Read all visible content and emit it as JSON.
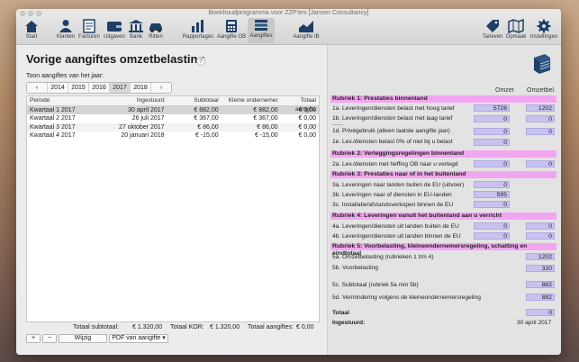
{
  "window": {
    "title": "Boekhoudprogramma voor ZZP'ers [Jansen Consultancy]"
  },
  "toolbar": {
    "items": [
      {
        "label": "Start",
        "icon": "home-icon"
      },
      {
        "label": "Klanten",
        "icon": "person-icon"
      },
      {
        "label": "Facturen",
        "icon": "invoice-icon"
      },
      {
        "label": "Uitgaven",
        "icon": "wallet-icon"
      },
      {
        "label": "Bank",
        "icon": "bank-icon"
      },
      {
        "label": "Ritten",
        "icon": "car-icon"
      },
      {
        "label": "Rapportages",
        "icon": "bar-chart-icon"
      },
      {
        "label": "Aangifte OB",
        "icon": "calculator-icon"
      },
      {
        "label": "Aangiftes",
        "icon": "stack-icon"
      },
      {
        "label": "Aangifte IB",
        "icon": "area-chart-icon"
      },
      {
        "label": "Tarieven",
        "icon": "tag-icon"
      },
      {
        "label": "Opmaak",
        "icon": "map-icon"
      },
      {
        "label": "Instellingen",
        "icon": "gear-icon"
      }
    ],
    "active": "Aangiftes"
  },
  "left": {
    "title": "Vorige aangiftes omzetbelasting",
    "help": "?",
    "subtitle": "Toon aangiftes van het jaar:",
    "years": {
      "prev": "‹",
      "list": [
        "2014",
        "2015",
        "2016",
        "2017",
        "2018"
      ],
      "selected": "2017",
      "next": "›"
    },
    "table": {
      "headers": [
        "Periode",
        "Ingestuurd",
        "Subtotaal",
        "Kleine ondernemer",
        "Totaal aangifte"
      ],
      "rows": [
        [
          "Kwartaal 1 2017",
          "30 april 2017",
          "€ 882,00",
          "€ 882,00",
          "€ 0,00"
        ],
        [
          "Kwartaal 2 2017",
          "26 juli 2017",
          "€ 367,00",
          "€ 367,00",
          "€ 0,00"
        ],
        [
          "Kwartaal 3 2017",
          "27 oktober 2017",
          "€ 86,00",
          "€ 86,00",
          "€ 0,00"
        ],
        [
          "Kwartaal 4 2017",
          "20 januari 2018",
          "€ -15,00",
          "€ -15,00",
          "€ 0,00"
        ]
      ]
    },
    "totals": {
      "subtotaal_label": "Totaal subtotaal:",
      "subtotaal": "€ 1.320,00",
      "kor_label": "Totaal KOR:",
      "kor": "€ 1.320,00",
      "aangiftes_label": "Totaal aangiftes:",
      "aangiftes": "€ 0,00"
    },
    "buttons": {
      "add": "+",
      "remove": "−",
      "edit": "Wijzig",
      "pdf": "PDF van aangifte ▾"
    }
  },
  "right": {
    "col_omzet": "Omzet",
    "col_omzetbel": "Omzetbel.",
    "sections": [
      {
        "title": "Rubriek 1: Prestaties binnenland"
      },
      {
        "title": "Rubriek 2: Verleggingsregelingen binnenland"
      },
      {
        "title": "Rubriek 3: Prestaties naar of in het buitenland"
      },
      {
        "title": "Rubriek 4: Leveringen vanuit het buitenland aan u verricht"
      },
      {
        "title": "Rubriek 5: Voorbelasting, kleineondernemersregeling, schatting en eindtotaal"
      }
    ],
    "lines": {
      "1a": {
        "label": "1a. Leveringen/diensten belast met hoog tarief",
        "omzet": "5726",
        "bel": "1202"
      },
      "1b": {
        "label": "1b. Leveringen/diensten belast met laag tarief",
        "omzet": "0",
        "bel": "0"
      },
      "1d": {
        "label": "1d. Privégebruik (alleen laatste aangifte jaar)",
        "omzet": "0",
        "bel": "0"
      },
      "1e": {
        "label": "1e. Lev./diensten belast 0% of niet bij u belast",
        "omzet": "0"
      },
      "2a": {
        "label": "2a. Lev./diensten met heffing OB naar u verlegd",
        "omzet": "0",
        "bel": "0"
      },
      "3a": {
        "label": "3a. Leveringen naar landen buiten de EU (uitvoer)",
        "omzet": "0"
      },
      "3b": {
        "label": "3b. Leveringen naar of diensten in EU-landen",
        "omzet": "595"
      },
      "3c": {
        "label": "3c. Installatie/afstandsverkopen binnen de EU",
        "omzet": "0"
      },
      "4a": {
        "label": "4a. Leveringen/diensten uit landen buiten de EU",
        "omzet": "0",
        "bel": "0"
      },
      "4b": {
        "label": "4b. Leveringen/diensten uit landen binnen de EU",
        "omzet": "0",
        "bel": "0"
      },
      "5a": {
        "label": "5a. Omzetbelasting (rubrieken 1 t/m 4)",
        "bel": "1202"
      },
      "5b": {
        "label": "5b. Voorbelasting",
        "bel": "320"
      },
      "5c": {
        "label": "5c. Subtotaal (rubriek 5a min 5b)",
        "bel": "882"
      },
      "5d": {
        "label": "5d. Vermindering volgens de kleineondernemersregeling",
        "bel": "882"
      }
    },
    "dash": "------",
    "total_label": "Totaal",
    "total_value": "0",
    "ingestuurd_label": "Ingestuurd:",
    "ingestuurd_value": "30 april 2017"
  },
  "colors": {
    "section_bg": "#f2a6f2",
    "value_box": "#c7c2ef",
    "selected_row": "#d4d4d4"
  }
}
